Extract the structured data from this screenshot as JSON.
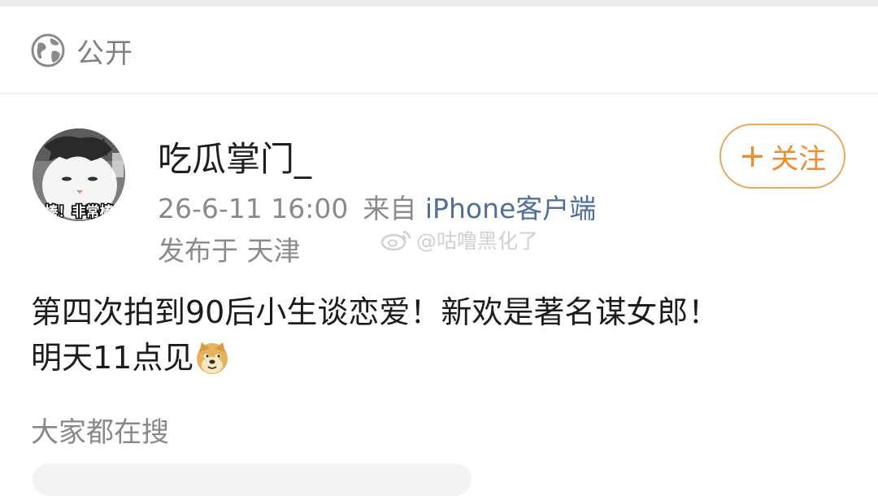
{
  "visibility": {
    "icon": "globe-icon",
    "label": "公开"
  },
  "post": {
    "author": "吃瓜掌门_",
    "avatar_caption": "棒！非常棒",
    "timestamp": "26-6-11 16:00",
    "source_prefix": "来自",
    "source_client": "iPhone客户端",
    "location": "发布于 天津",
    "content_line1": "第四次拍到90后小生谈恋爱！新欢是著名谋女郎！",
    "content_line2": "明天11点见",
    "emoji": "doge-emoji"
  },
  "follow_button": {
    "plus": "+",
    "label": "关注"
  },
  "watermark": "@咕噜黑化了",
  "trending_label": "大家都在搜",
  "colors": {
    "accent_orange": "#ef8b32",
    "link_blue": "#4f6e98",
    "muted_gray": "#8a8a8a"
  }
}
